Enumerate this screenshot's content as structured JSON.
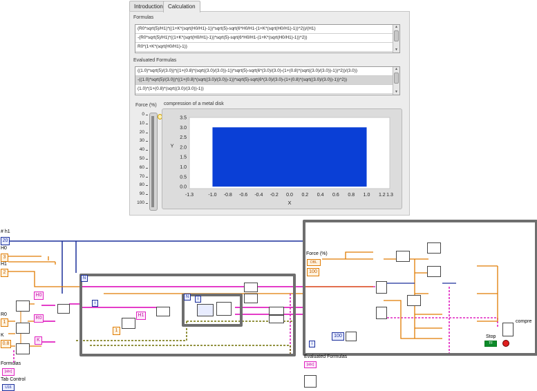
{
  "tabs": [
    "Introduction",
    "Calculation"
  ],
  "formulas": {
    "label": "Formulas",
    "rows": [
      "(R0*sqrt(5)/H1)*((1+K*(sqrt(H0/H1)-1))*sqrt(5)-sqrt(6*H0/H1-(1+K*(sqrt(H0/H1)-1))^2))/(H1)",
      "-(R0*sqrt(5)/H1)*((1+K*(sqrt(H0/H1)-1))*sqrt(5)-sqrt(6*H0/H1-(1+K*(sqrt(H0/H1)-1))^2))",
      "R0*(1+K*(sqrt(H0/H1)-1))"
    ]
  },
  "evaluated": {
    "label": "Evaluated Formulas",
    "rows": [
      "((1.0)*sqrt(5)/(3.0))*((1+(0.8)*(sqrt((3.0)/(3.0))-1))*sqrt(5)-sqrt(6*(3.0)/(3.0)-(1+(0.8)*(sqrt((3.0)/(3.0))-1))^2))/(3.0))",
      "-((1.0)*sqrt(5)/(3.0))*((1+(0.8)*(sqrt((3.0)/(3.0))-1))*sqrt(5)-sqrt(6*(3.0)/(3.0)-(1+(0.8)*(sqrt((3.0)/(3.0))-1))^2))",
      "(1.0)*(1+(0.8)*(sqrt((3.0)/(3.0))-1))"
    ]
  },
  "force": {
    "label": "Force (%)",
    "ticks": [
      "0",
      "10",
      "20",
      "30",
      "40",
      "50",
      "60",
      "70",
      "80",
      "90",
      "100"
    ],
    "value_pct": 0
  },
  "chart_data": {
    "type": "area",
    "title": "compression of a metal disk",
    "xlabel": "X",
    "ylabel": "Y",
    "xlim": [
      -1.3,
      1.3
    ],
    "ylim": [
      -0.1,
      3.5
    ],
    "xticks": [
      "-1.3",
      "-1.0",
      "-0.8",
      "-0.6",
      "-0.4",
      "-0.2",
      "0.0",
      "0.2",
      "0.4",
      "0.6",
      "0.8",
      "1.0",
      "1.2",
      "1.3"
    ],
    "xtick_values": [
      -1.3,
      -1.0,
      -0.8,
      -0.6,
      -0.4,
      -0.2,
      0.0,
      0.2,
      0.4,
      0.6,
      0.8,
      1.0,
      1.2,
      1.3
    ],
    "yticks": [
      "0.0",
      "0.5",
      "1.0",
      "1.5",
      "2.0",
      "2.5",
      "3.0",
      "3.5"
    ],
    "ytick_values": [
      0.0,
      0.5,
      1.0,
      1.5,
      2.0,
      2.5,
      3.0,
      3.5
    ],
    "series": [
      {
        "x": [
          -1.0,
          1.0
        ],
        "y_top": [
          3.0,
          3.0
        ],
        "y_bottom": [
          0.0,
          0.0
        ],
        "color": "#0a3fd6"
      }
    ]
  },
  "diagram": {
    "h1_label": "# h1",
    "h1_value": "20",
    "h0_label": "H0",
    "h0_value": "3",
    "H1_label": "H1",
    "H1_value": "2",
    "r0_label": "R0",
    "r0_value": "1",
    "k_label": "K",
    "k_value": "0.8",
    "formulas_label": "Formulas",
    "tab_control_label": "Tab Control",
    "force_label": "Force (%)",
    "const_100_a": "100",
    "const_100_b": "100",
    "evaluated_label": "Evaluated Formulas",
    "stop_label": "Stop",
    "compr_label": "compre",
    "n_label": "N",
    "i_label": "i",
    "H0_tag": "H0",
    "R0_tag": "R0",
    "K_tag": "K",
    "H1_tag": "H1"
  },
  "colors": {
    "orange_wire": "#e07b00",
    "blue_wire": "#1a2e9a",
    "pink_wire": "#e020c0",
    "plot_fill": "#0a3fd6"
  }
}
